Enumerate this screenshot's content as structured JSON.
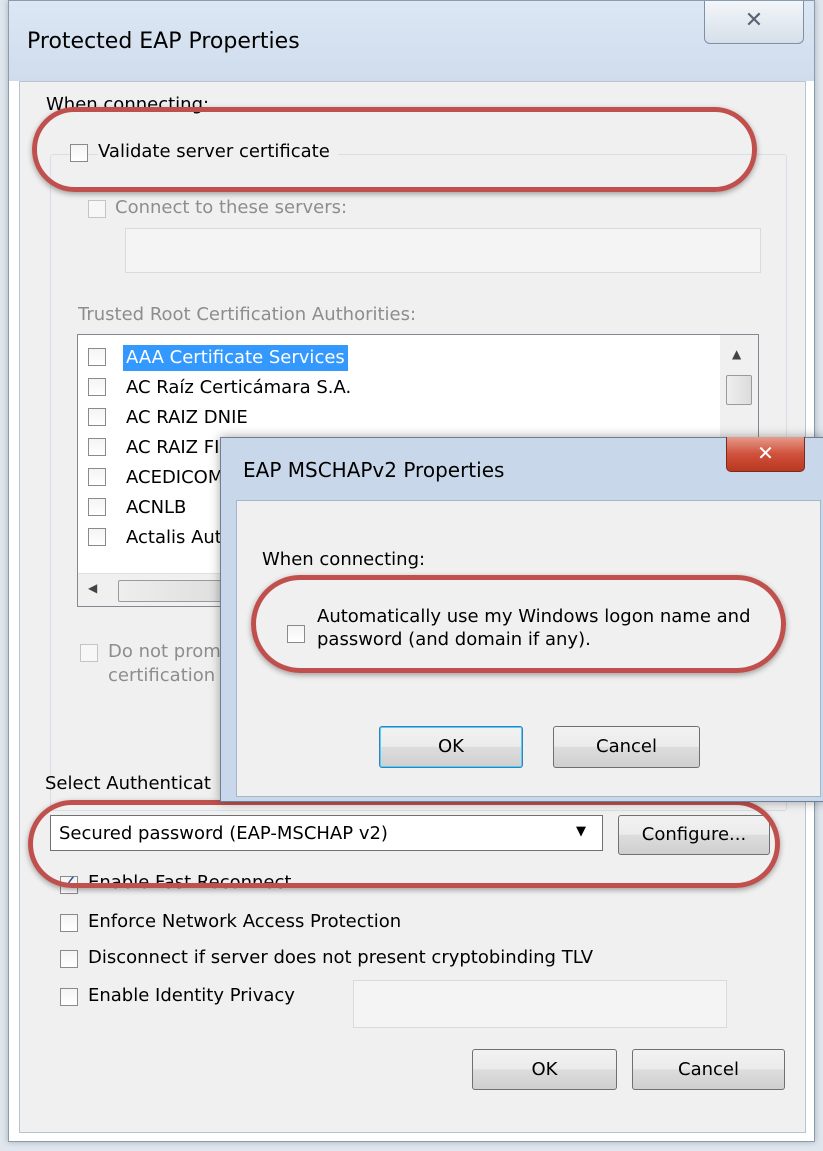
{
  "main_dialog": {
    "title": "Protected EAP Properties",
    "close_glyph": "✕",
    "when_connecting": "When connecting:",
    "validate_cert": {
      "label": "Validate server certificate",
      "checked": false
    },
    "connect_servers": {
      "label": "Connect to these servers:",
      "checked": false,
      "value": ""
    },
    "trusted_roots_label": "Trusted Root Certification Authorities:",
    "trusted_roots": [
      {
        "label": "AAA Certificate Services",
        "checked": false,
        "selected": true
      },
      {
        "label": "AC Raíz Certicámara S.A.",
        "checked": false,
        "selected": false
      },
      {
        "label": "AC RAIZ DNIE",
        "checked": false,
        "selected": false
      },
      {
        "label": "AC RAIZ FI",
        "checked": false,
        "selected": false
      },
      {
        "label": "ACEDICOM",
        "checked": false,
        "selected": false
      },
      {
        "label": "ACNLB",
        "checked": false,
        "selected": false
      },
      {
        "label": "Actalis Aut",
        "checked": false,
        "selected": false
      }
    ],
    "scroll_up_glyph": "▲",
    "scroll_left_glyph": "◀",
    "do_not_prompt_line1": "Do not prom",
    "do_not_prompt_line2": "certification",
    "select_auth_label": "Select Authenticat",
    "auth_method": "Secured password (EAP-MSCHAP v2)",
    "combo_arrow_glyph": "▼",
    "configure_button": "Configure...",
    "options": [
      {
        "label": "Enable Fast Reconnect",
        "checked": true
      },
      {
        "label": "Enforce Network Access Protection",
        "checked": false
      },
      {
        "label": "Disconnect if server does not present cryptobinding TLV",
        "checked": false
      },
      {
        "label": "Enable Identity Privacy",
        "checked": false
      }
    ],
    "identity_value": "",
    "ok_button": "OK",
    "cancel_button": "Cancel"
  },
  "mschap_dialog": {
    "title": "EAP MSCHAPv2 Properties",
    "close_glyph": "✕",
    "when_connecting": "When connecting:",
    "auto_logon_line1": "Automatically use my Windows logon name and",
    "auto_logon_line2": "password (and domain if any).",
    "auto_logon_checked": false,
    "ok_button": "OK",
    "cancel_button": "Cancel"
  },
  "colors": {
    "highlight_ring": "#c0504d",
    "selection": "#3399ff",
    "close_red": "#c84a35"
  }
}
